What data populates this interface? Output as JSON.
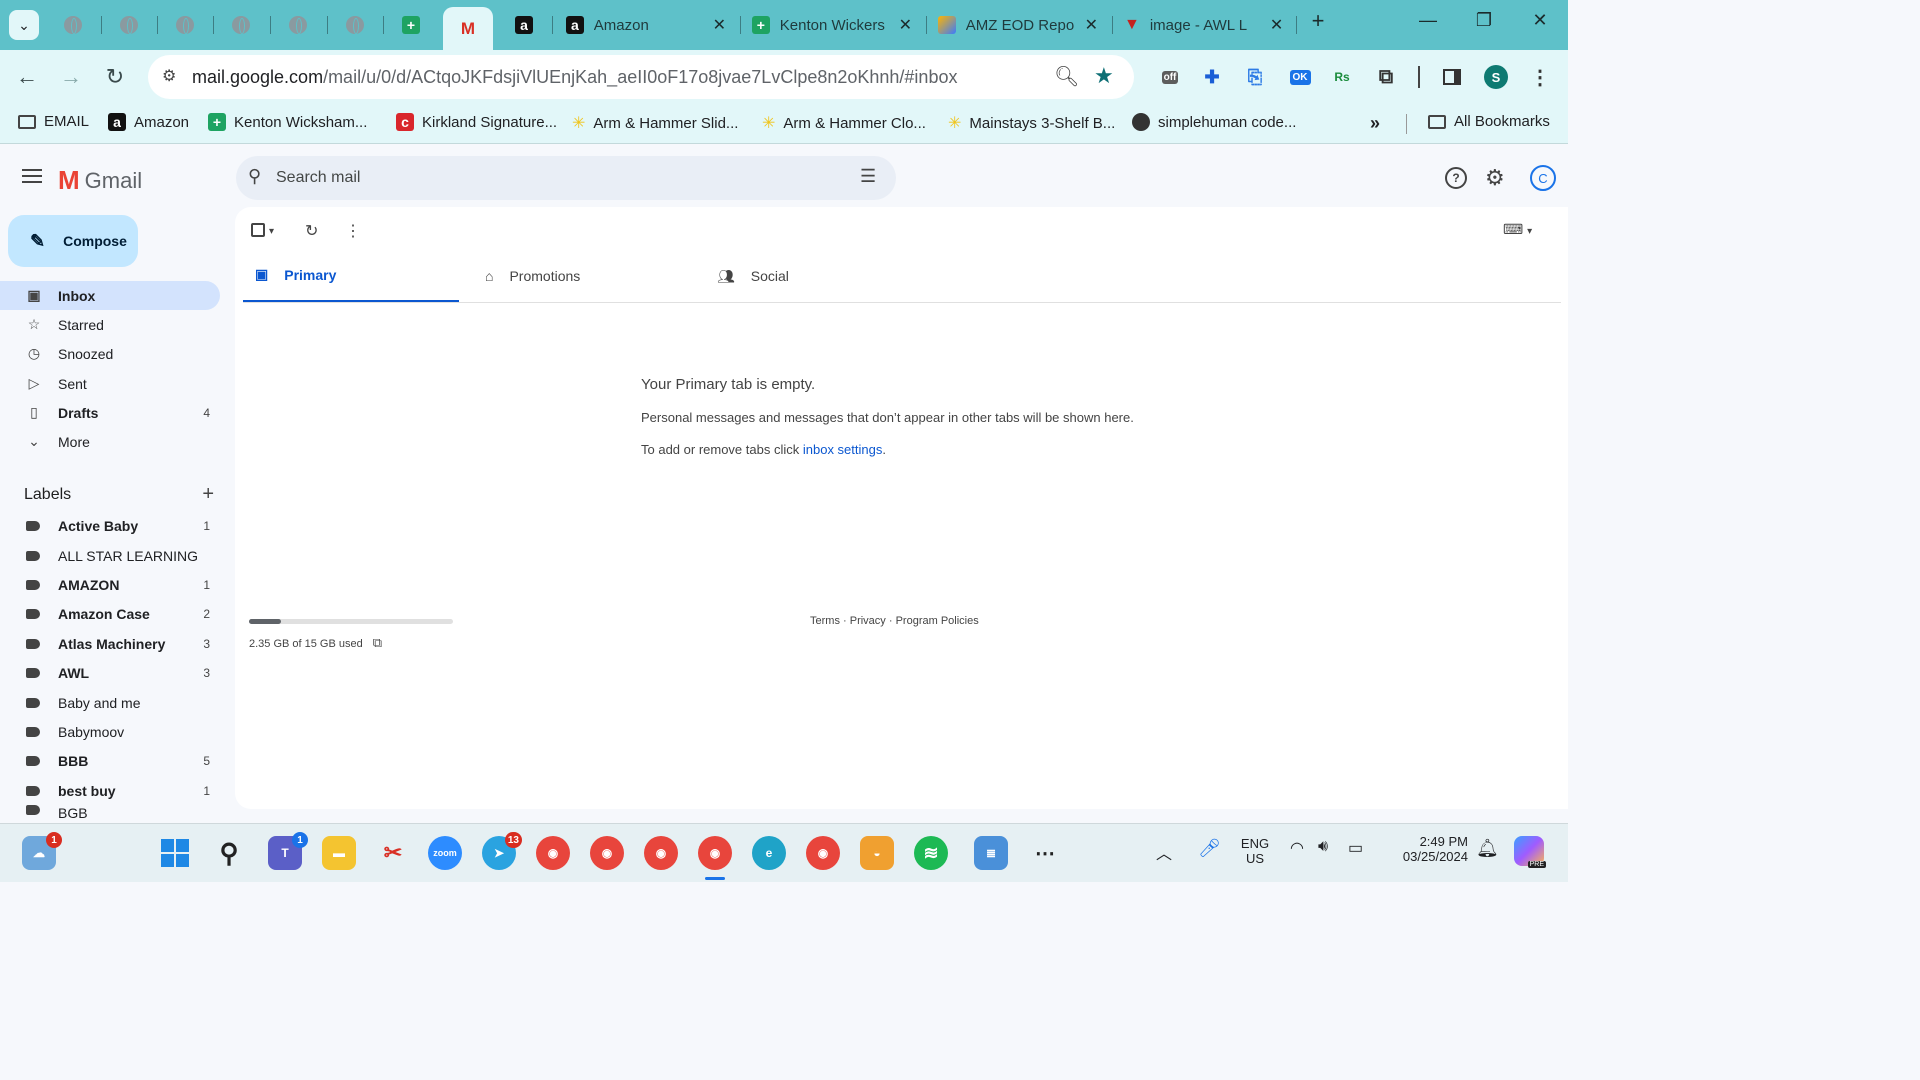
{
  "browser": {
    "tabs": [
      {
        "title": "Amazon"
      },
      {
        "title": "Kenton Wickers"
      },
      {
        "title": "AMZ EOD Repo"
      },
      {
        "title": "image - AWL L"
      }
    ],
    "url_host": "mail.google.com",
    "url_path": "/mail/u/0/d/ACtqoJKFdsjiVlUEnjKah_aeII0oF17o8jvae7LvClpe8n2oKhnh/#inbox",
    "ext_off": "off",
    "ext_ok": "OK",
    "ext_rs": "Rs",
    "profile_initial": "S",
    "bookmarks": [
      {
        "label": "EMAIL"
      },
      {
        "label": "Amazon"
      },
      {
        "label": "Kenton Wicksham..."
      },
      {
        "label": "Kirkland Signature..."
      },
      {
        "label": "Arm & Hammer Slid..."
      },
      {
        "label": "Arm & Hammer Clo..."
      },
      {
        "label": "Mainstays 3-Shelf B..."
      },
      {
        "label": "simplehuman code..."
      }
    ],
    "all_bookmarks": "All Bookmarks"
  },
  "gmail": {
    "logo_text": "Gmail",
    "search_placeholder": "Search mail",
    "account_initial": "C",
    "compose_label": "Compose",
    "nav": [
      {
        "label": "Inbox",
        "count": ""
      },
      {
        "label": "Starred",
        "count": ""
      },
      {
        "label": "Snoozed",
        "count": ""
      },
      {
        "label": "Sent",
        "count": ""
      },
      {
        "label": "Drafts",
        "count": "4"
      },
      {
        "label": "More",
        "count": ""
      }
    ],
    "labels_heading": "Labels",
    "labels": [
      {
        "name": "Active Baby",
        "count": "1"
      },
      {
        "name": "ALL STAR LEARNING",
        "count": ""
      },
      {
        "name": "AMAZON",
        "count": "1"
      },
      {
        "name": "Amazon Case",
        "count": "2"
      },
      {
        "name": "Atlas Machinery",
        "count": "3"
      },
      {
        "name": "AWL",
        "count": "3"
      },
      {
        "name": "Baby and me",
        "count": ""
      },
      {
        "name": "Babymoov",
        "count": ""
      },
      {
        "name": "BBB",
        "count": "5"
      },
      {
        "name": "best buy",
        "count": "1"
      },
      {
        "name": "BGB",
        "count": ""
      }
    ],
    "tabs": [
      {
        "label": "Primary"
      },
      {
        "label": "Promotions"
      },
      {
        "label": "Social"
      }
    ],
    "empty_title": "Your Primary tab is empty.",
    "empty_desc": "Personal messages and messages that don’t appear in other tabs will be shown here.",
    "empty_hint_prefix": "To add or remove tabs click ",
    "empty_hint_link": "inbox settings",
    "empty_hint_suffix": ".",
    "storage_text": "2.35 GB of 15 GB used",
    "storage_fraction": 0.157,
    "footer_terms": "Terms",
    "footer_privacy": "Privacy",
    "footer_policies": "Program Policies",
    "footer_sep": " · "
  },
  "taskbar": {
    "weather_badge": "1",
    "teams_badge": "1",
    "telegram_badge": "13",
    "zoom_label": "zoom",
    "lang_top": "ENG",
    "lang_bottom": "US",
    "time": "2:49 PM",
    "date": "03/25/2024",
    "copilot_badge": "PRE"
  },
  "colors": {
    "chrome_frame": "#5ec1c9",
    "toolbar": "#e2f7f9",
    "accent": "#0b57d0",
    "compose": "#c2e7ff",
    "active_nav": "#d3e3fd"
  }
}
